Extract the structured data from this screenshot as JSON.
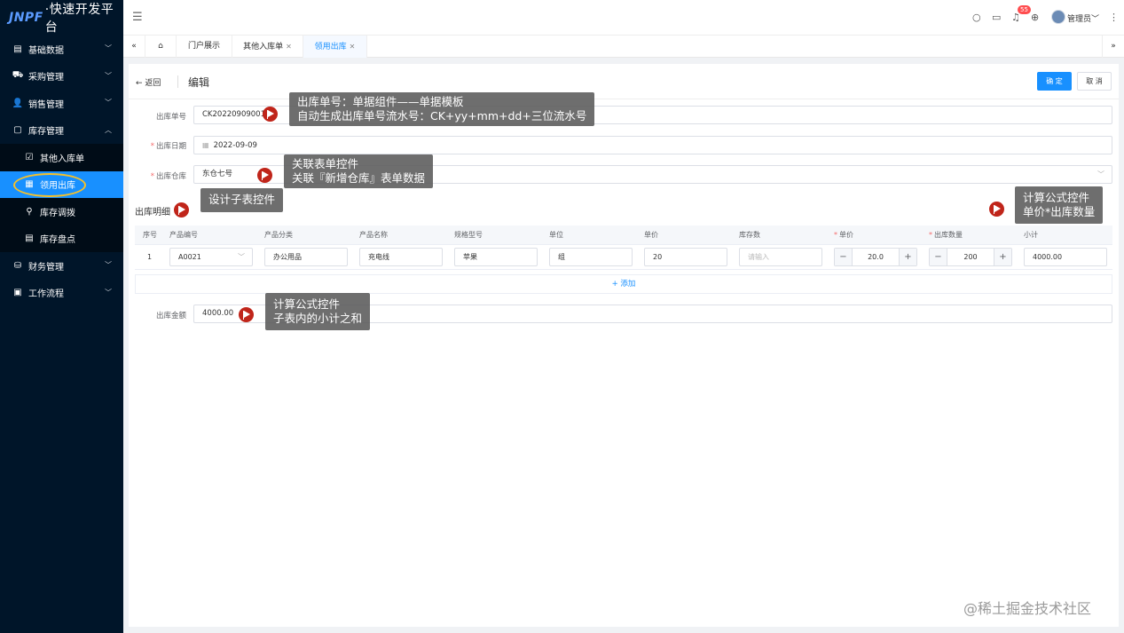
{
  "app": {
    "logo_brand": "JNPF",
    "logo_rest": "·快速开发平台"
  },
  "sidebar": {
    "items": [
      {
        "label": "基础数据",
        "icon": "▤"
      },
      {
        "label": "采购管理",
        "icon": "⛟"
      },
      {
        "label": "销售管理",
        "icon": "👤"
      },
      {
        "label": "库存管理",
        "icon": "▢"
      },
      {
        "label": "其他入库单",
        "icon": "☑"
      },
      {
        "label": "领用出库",
        "icon": "▦"
      },
      {
        "label": "库存调拨",
        "icon": "⚲"
      },
      {
        "label": "库存盘点",
        "icon": "▤"
      },
      {
        "label": "财务管理",
        "icon": "⛁"
      },
      {
        "label": "工作流程",
        "icon": "▣"
      }
    ]
  },
  "header": {
    "notification_count": "55",
    "username": "管理员"
  },
  "tabs": [
    {
      "label": "门户展示"
    },
    {
      "label": "其他入库单"
    },
    {
      "label": "领用出库"
    }
  ],
  "page": {
    "back_label": "返回",
    "title": "编辑",
    "confirm_label": "确 定",
    "cancel_label": "取 消"
  },
  "form": {
    "order_no_label": "出库单号",
    "order_no_value": "CK20220909001",
    "date_label": "出库日期",
    "date_value": "2022-09-09",
    "warehouse_label": "出库仓库",
    "warehouse_value": "东仓七号",
    "detail_title": "出库明细",
    "amount_label": "出库金额",
    "amount_value": "4000.00"
  },
  "table": {
    "headers": [
      "序号",
      "产品编号",
      "产品分类",
      "产品名称",
      "规格型号",
      "单位",
      "单价",
      "库存数",
      "单价",
      "出库数量",
      "小计"
    ],
    "row": {
      "index": "1",
      "code": "A0021",
      "category": "办公用品",
      "name": "充电线",
      "spec": "苹果",
      "unit": "组",
      "price": "20",
      "stock_placeholder": "请输入",
      "unit_price": "20.0",
      "qty": "200",
      "subtotal": "4000.00"
    },
    "add_label": "+ 添加"
  },
  "callouts": {
    "c1_line1": "出库单号：单据组件——单据模板",
    "c1_line2": "自动生成出库单号流水号：CK+yy+mm+dd+三位流水号",
    "c2_line1": "关联表单控件",
    "c2_line2": "关联『新增仓库』表单数据",
    "c3_line1": "设计子表控件",
    "c4_line1": "计算公式控件",
    "c4_line2": "单价*出库数量",
    "c5_line1": "计算公式控件",
    "c5_line2": "子表内的小计之和"
  },
  "watermark": "@稀土掘金技术社区"
}
